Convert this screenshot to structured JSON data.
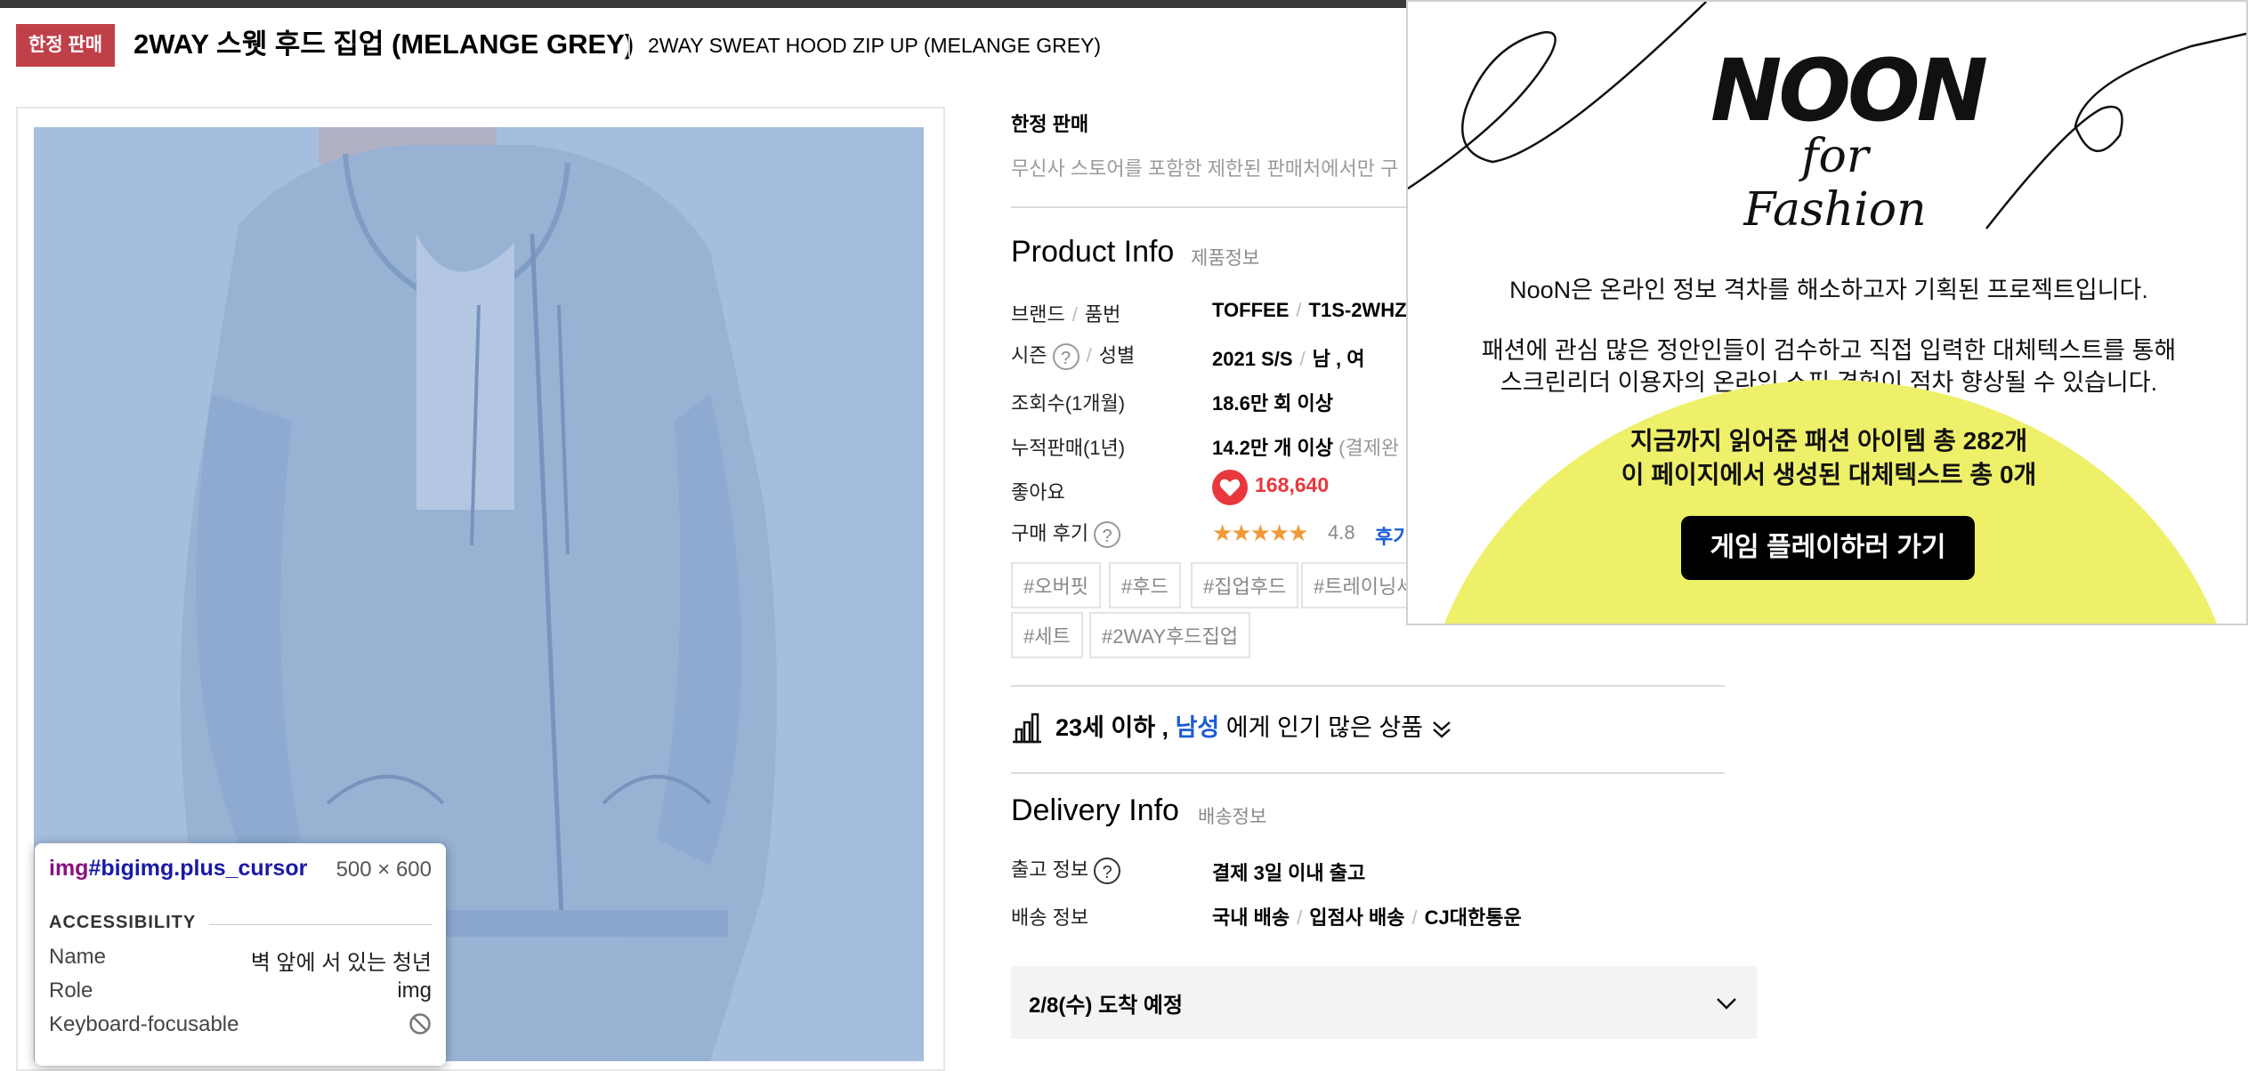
{
  "header": {
    "badge": "한정 판매",
    "title_ko": "2WAY 스웻 후드 집업 (MELANGE GREY)",
    "title_en": "2WAY SWEAT HOOD ZIP UP (MELANGE GREY)"
  },
  "devtools_tooltip": {
    "tag": "img",
    "selector": "#bigimg.plus_cursor",
    "size": "500 × 600",
    "section": "ACCESSIBILITY",
    "rows": [
      {
        "key": "Name",
        "value": "벽 앞에 서 있는 청년"
      },
      {
        "key": "Role",
        "value": "img"
      },
      {
        "key": "Keyboard-focusable",
        "value": ""
      }
    ],
    "not_focusable_icon": "no-entry-icon"
  },
  "limited": {
    "label": "한정 판매",
    "note": "무신사 스토어를 포함한 제한된 판매처에서만 구"
  },
  "product_info": {
    "title": "Product Info",
    "subtitle": "제품정보",
    "brand_label_a": "브랜드",
    "brand_label_b": "품번",
    "brand": "TOFFEE",
    "code": "T1S-2WHZ",
    "season_label": "시즌",
    "gender_label": "성별",
    "season": "2021 S/S",
    "gender": "남 , 여",
    "views_label": "조회수(1개월)",
    "views": "18.6만 회 이상",
    "sales_label": "누적판매(1년)",
    "sales": "14.2만 개 이상",
    "sales_note": "(결제완",
    "likes_label": "좋아요",
    "likes": "168,640",
    "review_label": "구매 후기",
    "stars": "★★★★★",
    "rating": "4.8",
    "review_link": "후기",
    "help_glyph": "?"
  },
  "tags": [
    "#오버핏",
    "#후드",
    "#집업후드",
    "#트레이닝세",
    "#세트",
    "#2WAY후드집업"
  ],
  "popular": {
    "age": "23세 이하 ,",
    "gender": "남성",
    "rest": "에게 인기 많은 상품"
  },
  "delivery": {
    "title": "Delivery Info",
    "subtitle": "배송정보",
    "ship_label": "출고 정보",
    "ship_value": "결제 3일 이내 출고",
    "method_label": "배송 정보",
    "method_a": "국내 배송",
    "method_b": "입점사 배송",
    "method_c": "CJ대한통운",
    "arrival": "2/8(수) 도착 예정"
  },
  "noon": {
    "logo_top": "NOON",
    "logo_bottom": "for Fashion",
    "line1": "NooN은 온라인 정보 격차를 해소하고자 기획된 프로젝트입니다.",
    "line2": "패션에 관심 많은 정안인들이 검수하고 직접 입력한 대체텍스트를 통해",
    "line3": "스크린리더 이용자의 온라인 쇼핑 경험이 점차 향상될 수 있습니다.",
    "stat1": "지금까지 읽어준 패션 아이템 총 282개",
    "stat2": "이 페이지에서 생성된 대체텍스트 총 0개",
    "button": "게임 플레이하러 가기"
  },
  "colors": {
    "badge": "#c0404a",
    "image_overlay": "#a5bedd",
    "accent_blue": "#1a5cd6",
    "heart_red": "#e8383d",
    "star_orange": "#f29a38",
    "noon_yellow": "#eef069"
  }
}
